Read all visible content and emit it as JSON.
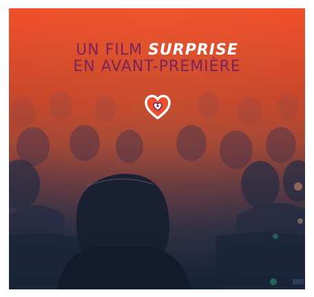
{
  "poster": {
    "headline_line1_prefix": "UN FILM ",
    "headline_line1_emphasis": "SURPRISE",
    "headline_line2": "EN AVANT-PREMIÈRE",
    "icon": "heart-icon"
  },
  "colors": {
    "background_top": "#f0502a",
    "background_bottom": "#1e2b42",
    "headline_text": "#7a2458",
    "emphasis_text": "#ffffff",
    "heart_outline": "#ffffff",
    "heart_inner": "#7a2458"
  }
}
